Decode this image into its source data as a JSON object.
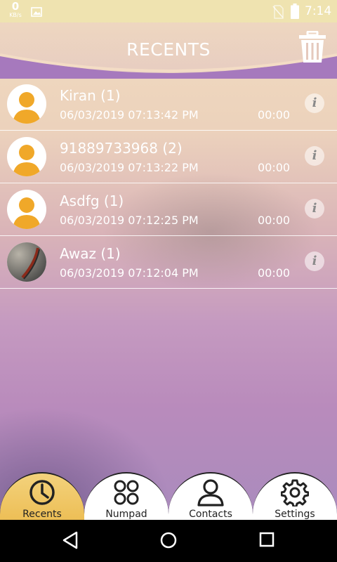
{
  "status_bar": {
    "speed_value": "0",
    "speed_unit": "KB/s",
    "time": "7:14",
    "icons": [
      "image-icon",
      "no-sim-icon",
      "battery-icon"
    ]
  },
  "header": {
    "title": "RECENTS",
    "delete_icon": "trash-icon"
  },
  "calls": [
    {
      "name": "Kiran (1)",
      "datetime": "06/03/2019 07:13:42 PM",
      "duration": "00:00",
      "avatar": "default-avatar"
    },
    {
      "name": "91889733968 (2)",
      "datetime": "06/03/2019 07:13:22 PM",
      "duration": "00:00",
      "avatar": "default-avatar"
    },
    {
      "name": "Asdfg (1)",
      "datetime": "06/03/2019 07:12:25 PM",
      "duration": "00:00",
      "avatar": "default-avatar"
    },
    {
      "name": "Awaz (1)",
      "datetime": "06/03/2019 07:12:04 PM",
      "duration": "00:00",
      "avatar": "photo-avatar"
    }
  ],
  "info_glyph": "i",
  "tabs": [
    {
      "label": "Recents",
      "icon": "clock-icon",
      "active": true
    },
    {
      "label": "Numpad",
      "icon": "numpad-icon",
      "active": false
    },
    {
      "label": "Contacts",
      "icon": "person-icon",
      "active": false
    },
    {
      "label": "Settings",
      "icon": "gear-icon",
      "active": false
    }
  ],
  "colors": {
    "avatar_orange": "#f0a829",
    "active_tab": "#e9b23e",
    "header_purple": "#a679bd"
  }
}
